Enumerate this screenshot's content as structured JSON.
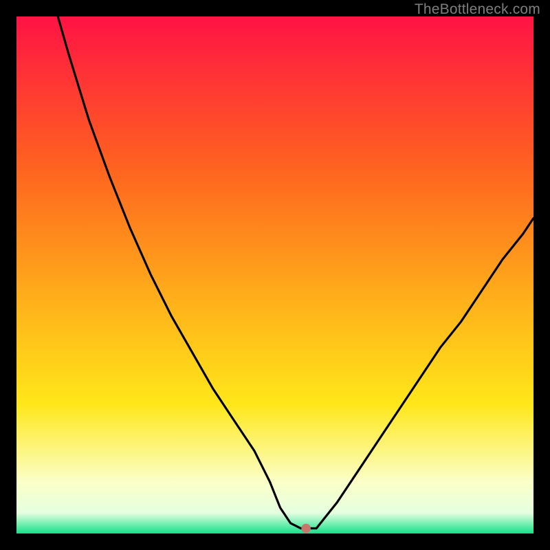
{
  "watermark": "TheBottleneck.com",
  "colors": {
    "top": "#ff1344",
    "mid_upper": "#ff8a1f",
    "mid": "#ffe71a",
    "mid_lower": "#fdffb9",
    "bottom": "#15e08a",
    "curve_stroke": "#000000",
    "marker_fill": "#c9766a",
    "background": "#000000"
  },
  "chart_data": {
    "type": "line",
    "title": "",
    "xlabel": "",
    "ylabel": "",
    "xlim": [
      0,
      100
    ],
    "ylim": [
      0,
      100
    ],
    "x": [
      8,
      10,
      14,
      18,
      22,
      26,
      30,
      34,
      38,
      42,
      46,
      49,
      51,
      53,
      55,
      58,
      62,
      66,
      70,
      74,
      78,
      82,
      86,
      90,
      94,
      98,
      100
    ],
    "values": [
      100,
      93,
      80,
      69,
      59,
      50,
      42,
      35,
      28,
      22,
      16,
      10,
      5,
      2,
      1,
      1,
      6,
      12,
      18,
      24,
      30,
      36,
      41,
      47,
      53,
      58,
      61
    ],
    "curve_note": "V-shaped bottleneck curve; minimum near x≈55, y≈1",
    "marker": {
      "x": 56,
      "y": 1,
      "radius_pct": 0.9
    },
    "x_precision_note": "values estimated from plot; no axis tick labels present"
  }
}
